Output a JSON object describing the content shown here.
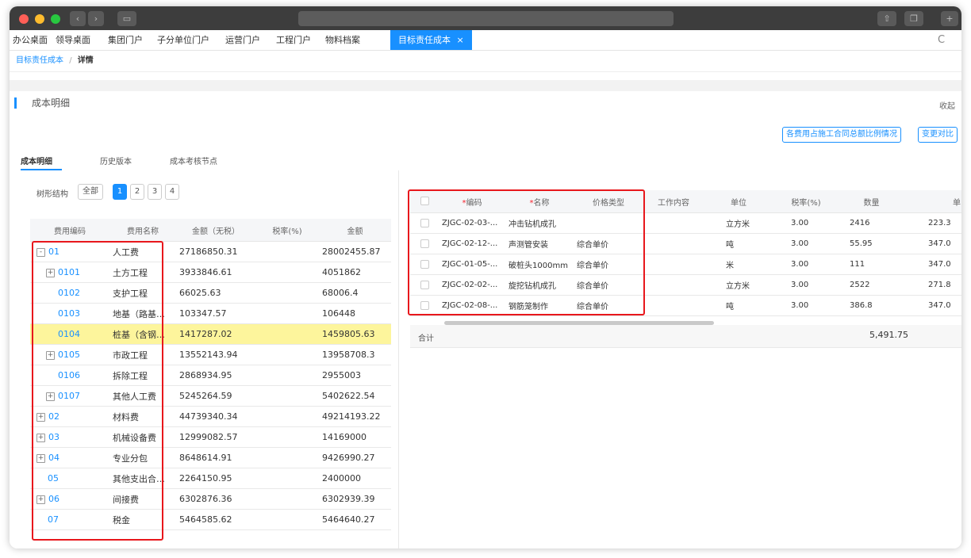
{
  "nav_tabs": [
    "办公桌面",
    "领导桌面",
    "集团门户",
    "子分单位门户",
    "运营门户",
    "工程门户",
    "物料档案"
  ],
  "active_tab": {
    "label": "目标责任成本",
    "close": "×"
  },
  "reload_glyph": "C",
  "breadcrumb": {
    "parent": "目标责任成本",
    "sep": "/",
    "current": "详情"
  },
  "section": {
    "title": "成本明细",
    "collapse": "收起"
  },
  "buttons": {
    "ratio": "各费用占施工合同总额比例情况",
    "compare": "变更对比"
  },
  "tabs": [
    "成本明细",
    "历史版本",
    "成本考核节点"
  ],
  "filter": {
    "label": "树形结构",
    "all": "全部",
    "levels": [
      "1",
      "2",
      "3",
      "4"
    ]
  },
  "left_table": {
    "headers": [
      "费用编码",
      "费用名称",
      "金额（无税）",
      "税率(%)",
      "金额"
    ],
    "rows": [
      {
        "code": "01",
        "name": "人工费",
        "amount_ex": "27186850.31",
        "rate": "",
        "amount": "28002455.87"
      },
      {
        "code": "0101",
        "name": "土方工程",
        "amount_ex": "3933846.61",
        "rate": "",
        "amount": "4051862"
      },
      {
        "code": "0102",
        "name": "支护工程",
        "amount_ex": "66025.63",
        "rate": "",
        "amount": "68006.4"
      },
      {
        "code": "0103",
        "name": "地基（路基）...",
        "amount_ex": "103347.57",
        "rate": "",
        "amount": "106448"
      },
      {
        "code": "0104",
        "name": "桩基（含钢筋...",
        "amount_ex": "1417287.02",
        "rate": "",
        "amount": "1459805.63"
      },
      {
        "code": "0105",
        "name": "市政工程",
        "amount_ex": "13552143.94",
        "rate": "",
        "amount": "13958708.3"
      },
      {
        "code": "0106",
        "name": "拆除工程",
        "amount_ex": "2868934.95",
        "rate": "",
        "amount": "2955003"
      },
      {
        "code": "0107",
        "name": "其他人工费",
        "amount_ex": "5245264.59",
        "rate": "",
        "amount": "5402622.54"
      },
      {
        "code": "02",
        "name": "材料费",
        "amount_ex": "44739340.34",
        "rate": "",
        "amount": "49214193.22"
      },
      {
        "code": "03",
        "name": "机械设备费",
        "amount_ex": "12999082.57",
        "rate": "",
        "amount": "14169000"
      },
      {
        "code": "04",
        "name": "专业分包",
        "amount_ex": "8648614.91",
        "rate": "",
        "amount": "9426990.27"
      },
      {
        "code": "05",
        "name": "其他支出合同...",
        "amount_ex": "2264150.95",
        "rate": "",
        "amount": "2400000"
      },
      {
        "code": "06",
        "name": "间接费",
        "amount_ex": "6302876.36",
        "rate": "",
        "amount": "6302939.39"
      },
      {
        "code": "07",
        "name": "税金",
        "amount_ex": "5464585.62",
        "rate": "",
        "amount": "5464640.27"
      }
    ]
  },
  "right_table": {
    "headers": {
      "code": "编码",
      "name": "名称",
      "price_type": "价格类型",
      "work": "工作内容",
      "unit": "单位",
      "rate": "税率(%)",
      "qty": "数量",
      "price": "单"
    },
    "required_mark": "*",
    "rows": [
      {
        "code": "ZJGC-02-03-...",
        "name": "冲击钻机成孔",
        "price_type": "",
        "work": "",
        "unit": "立方米",
        "rate": "3.00",
        "qty": "2416",
        "price": "223.3"
      },
      {
        "code": "ZJGC-02-12-...",
        "name": "声测管安装",
        "price_type": "综合单价",
        "work": "",
        "unit": "吨",
        "rate": "3.00",
        "qty": "55.95",
        "price": "347.0"
      },
      {
        "code": "ZJGC-01-05-...",
        "name": "破桩头1000mm",
        "price_type": "综合单价",
        "work": "",
        "unit": "米",
        "rate": "3.00",
        "qty": "111",
        "price": "347.0"
      },
      {
        "code": "ZJGC-02-02-...",
        "name": "旋挖钻机成孔",
        "price_type": "综合单价",
        "work": "",
        "unit": "立方米",
        "rate": "3.00",
        "qty": "2522",
        "price": "271.8"
      },
      {
        "code": "ZJGC-02-08-...",
        "name": "钢筋笼制作",
        "price_type": "综合单价",
        "work": "",
        "unit": "吨",
        "rate": "3.00",
        "qty": "386.8",
        "price": "347.0"
      }
    ],
    "total_label": "合计",
    "total_qty": "5,491.75"
  },
  "colors": {
    "accent": "#1890ff",
    "highlight": "#fdf59c",
    "annotation": "#e8171c",
    "titlebar": "#3d3d3d"
  }
}
